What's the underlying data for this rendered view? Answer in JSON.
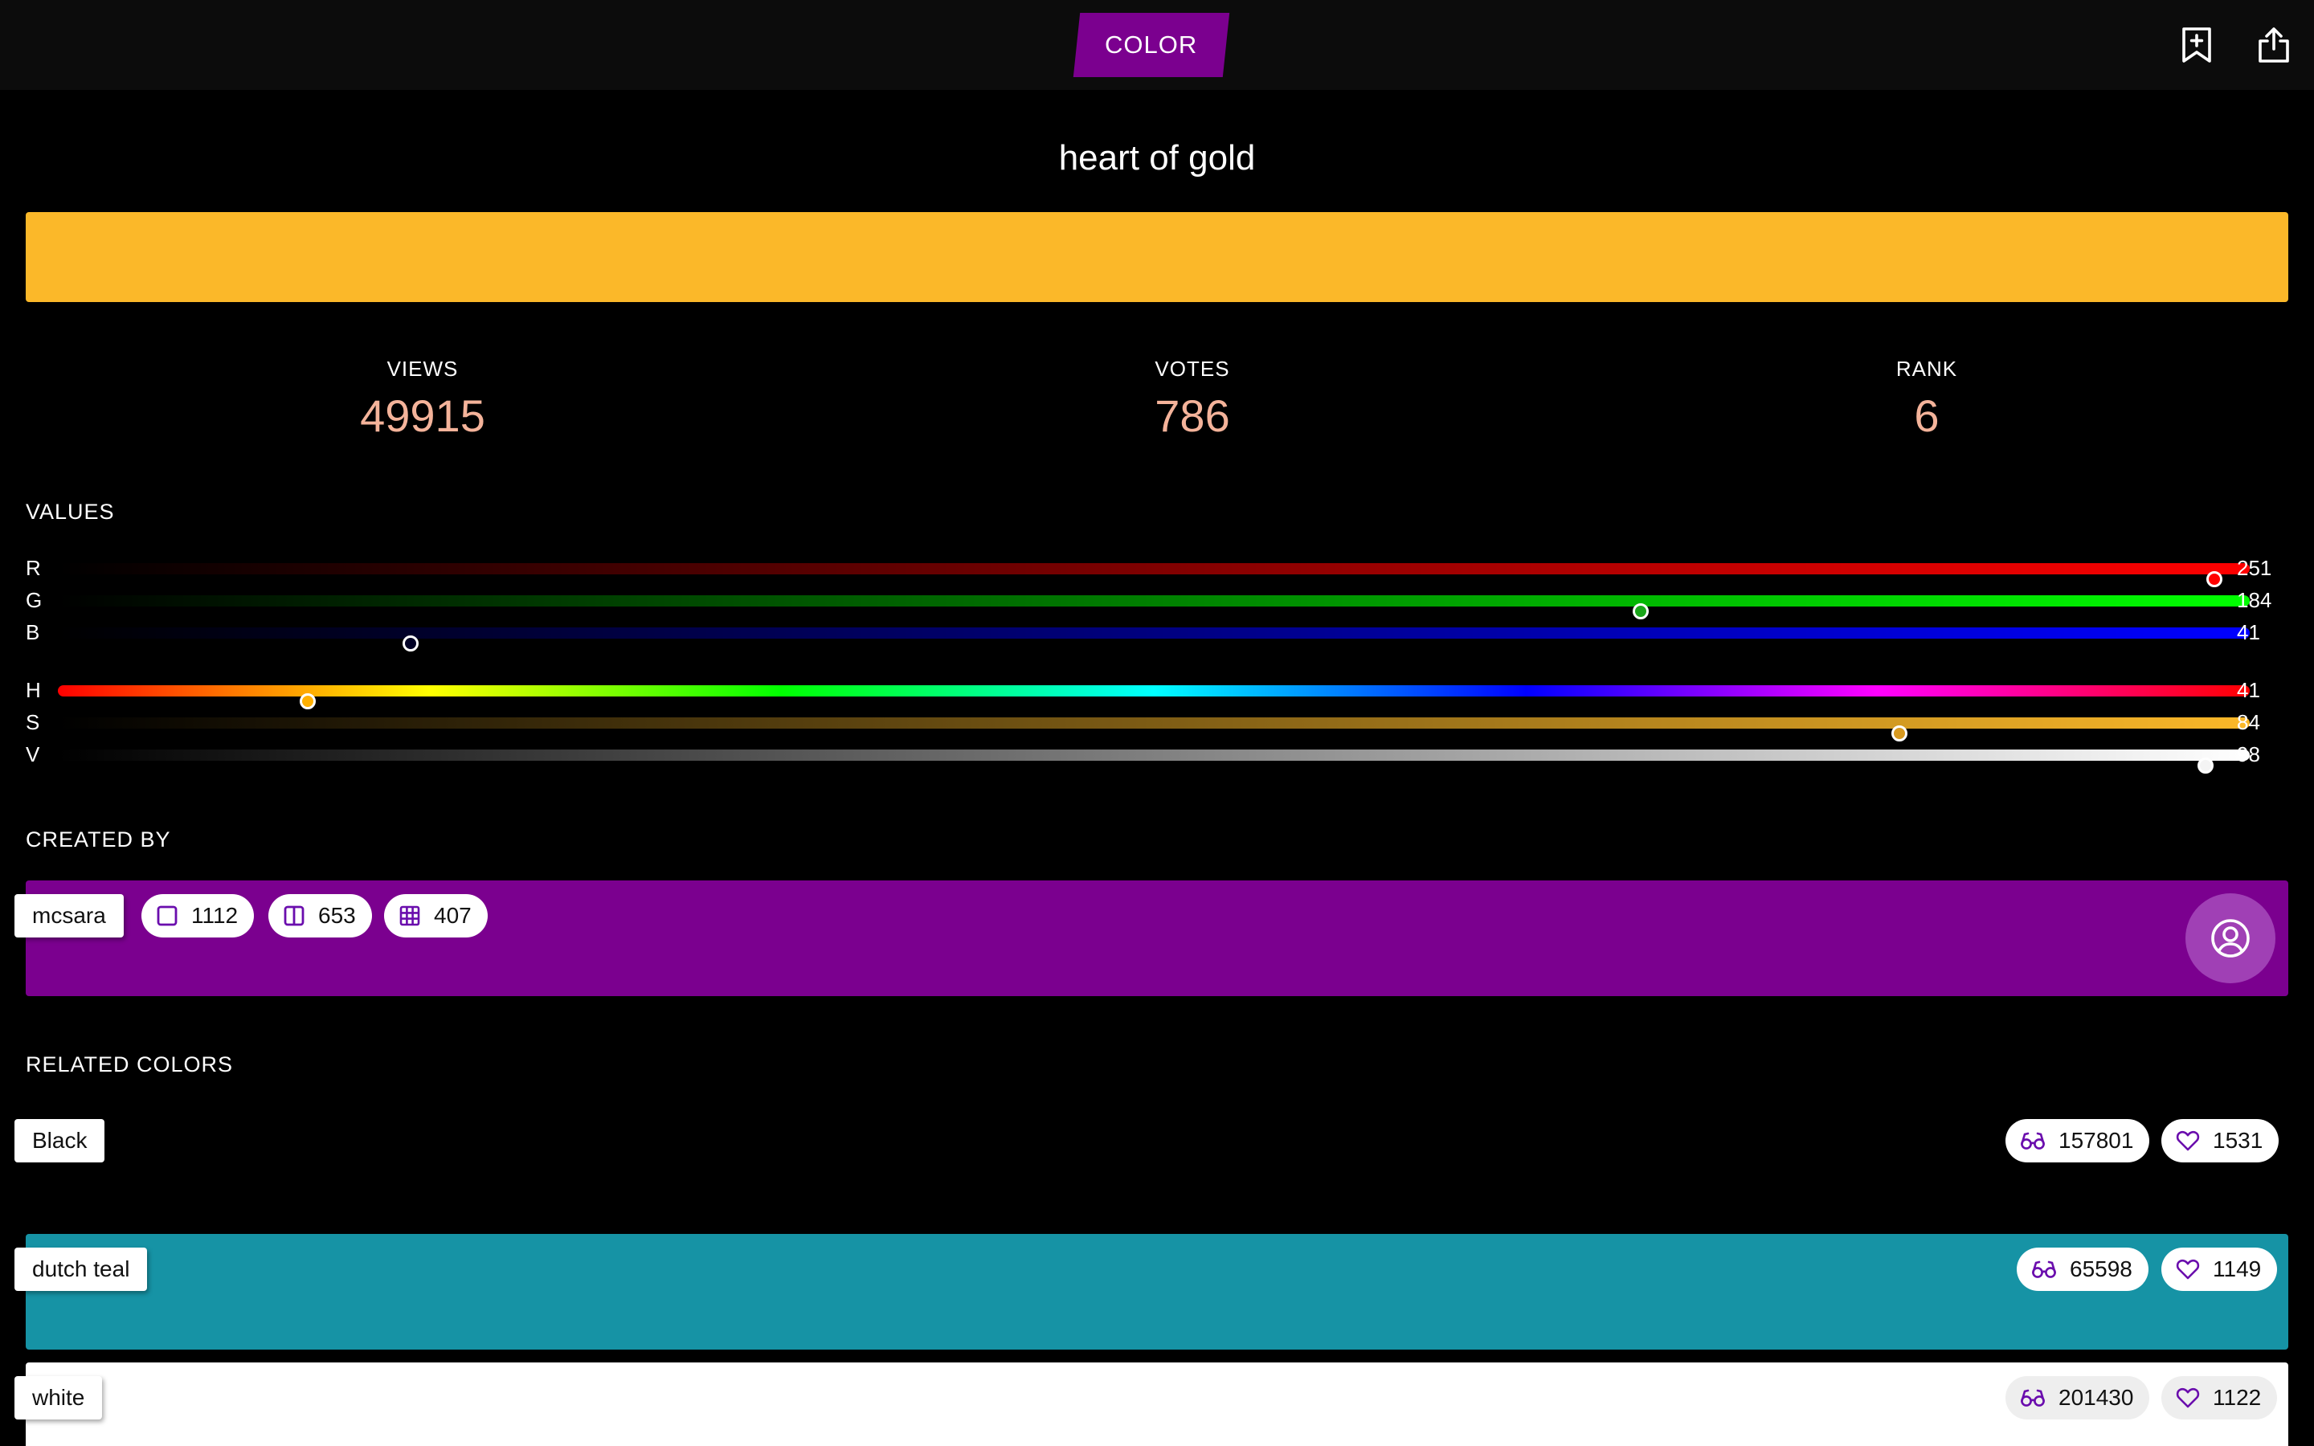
{
  "header": {
    "tab_label": "COLOR",
    "icons": [
      "bookmark-add-icon",
      "share-icon"
    ]
  },
  "color": {
    "name": "heart of gold",
    "hex": "#fbb829"
  },
  "stats": [
    {
      "label": "VIEWS",
      "value": "49915"
    },
    {
      "label": "VOTES",
      "value": "786"
    },
    {
      "label": "RANK",
      "value": "6"
    }
  ],
  "values": {
    "heading": "VALUES",
    "channels": [
      {
        "label": "R",
        "value": "251",
        "fraction": 0.984
      },
      {
        "label": "G",
        "value": "184",
        "fraction": 0.722
      },
      {
        "label": "B",
        "value": "41",
        "fraction": 0.161
      },
      {
        "label": "H",
        "value": "41",
        "fraction": 0.114
      },
      {
        "label": "S",
        "value": "84",
        "fraction": 0.84
      },
      {
        "label": "V",
        "value": "98",
        "fraction": 0.98
      }
    ]
  },
  "creator": {
    "heading": "CREATED BY",
    "username": "mcsara",
    "color": "#7b008f",
    "counts": [
      {
        "icon": "square-icon",
        "value": "1112"
      },
      {
        "icon": "columns-icon",
        "value": "653"
      },
      {
        "icon": "grid-icon",
        "value": "407"
      }
    ]
  },
  "related": {
    "heading": "RELATED COLORS",
    "items": [
      {
        "name": "Black",
        "color": "#000000",
        "views": "157801",
        "likes": "1531"
      },
      {
        "name": "dutch teal",
        "color": "#1693a5",
        "views": "65598",
        "likes": "1149"
      },
      {
        "name": "white",
        "color": "#ffffff",
        "views": "201430",
        "likes": "1122"
      }
    ]
  }
}
